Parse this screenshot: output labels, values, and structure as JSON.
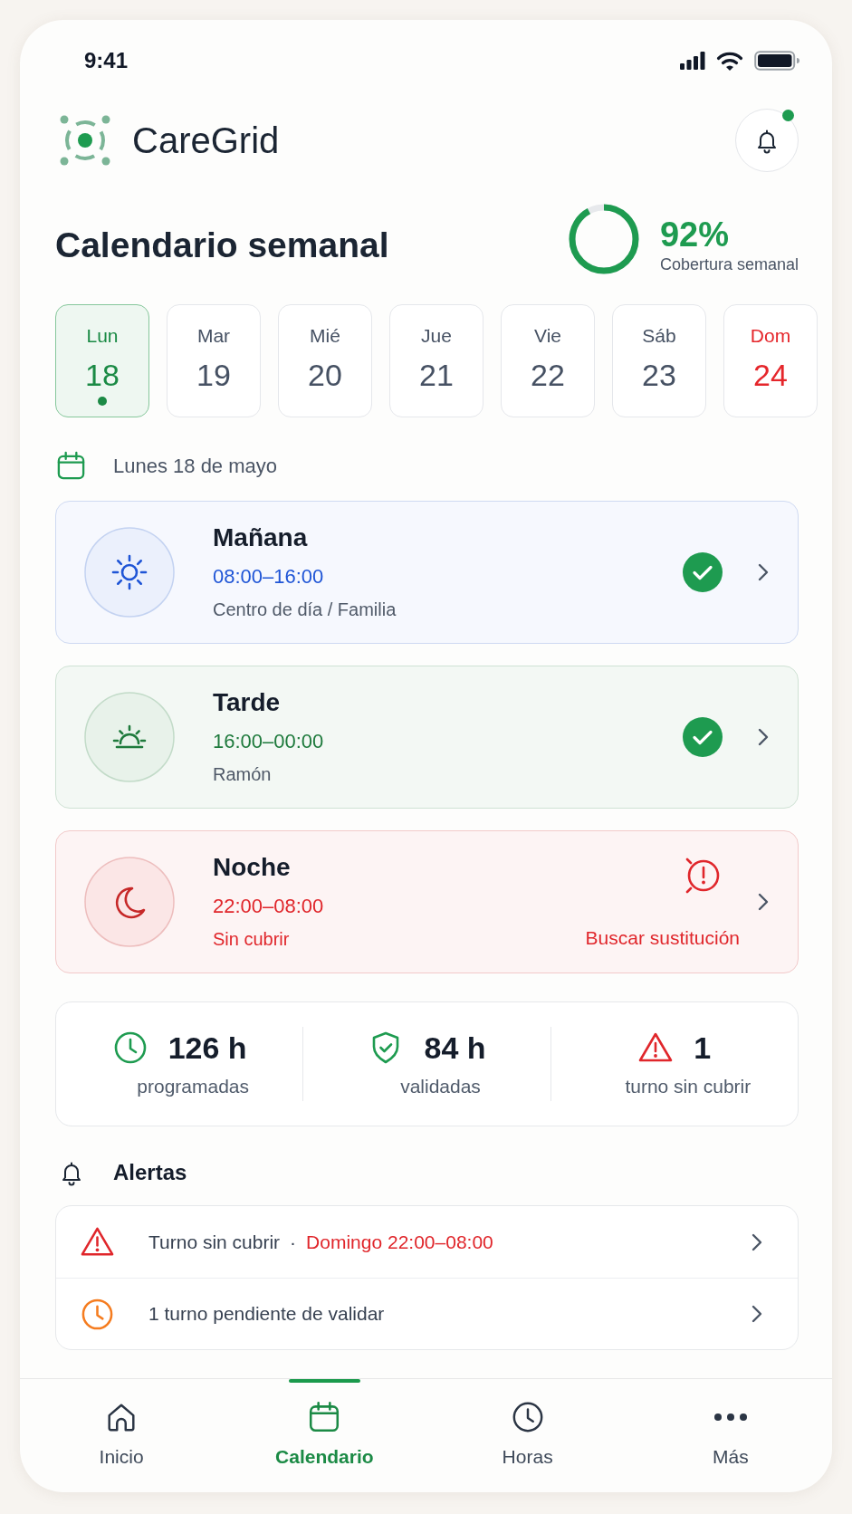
{
  "status_bar": {
    "time": "9:41"
  },
  "header": {
    "app_name": "CareGrid",
    "notifications_unread": true
  },
  "title": "Calendario semanal",
  "coverage": {
    "value": "92%",
    "label": "Cobertura semanal",
    "level": 0.92
  },
  "days": [
    {
      "name": "Lun",
      "number": "18",
      "selected": true,
      "holiday": false
    },
    {
      "name": "Mar",
      "number": "19",
      "selected": false,
      "holiday": false
    },
    {
      "name": "Mié",
      "number": "20",
      "selected": false,
      "holiday": false
    },
    {
      "name": "Jue",
      "number": "21",
      "selected": false,
      "holiday": false
    },
    {
      "name": "Vie",
      "number": "22",
      "selected": false,
      "holiday": false
    },
    {
      "name": "Sáb",
      "number": "23",
      "selected": false,
      "holiday": false
    },
    {
      "name": "Dom",
      "number": "24",
      "selected": false,
      "holiday": true
    }
  ],
  "date_label": "Lunes 18 de mayo",
  "shifts": [
    {
      "kind": "morning",
      "title": "Mañana",
      "time": "08:00–16:00",
      "assignee": "Centro de día / Familia",
      "covered": true
    },
    {
      "kind": "afternoon",
      "title": "Tarde",
      "time": "16:00–00:00",
      "assignee": "Ramón",
      "covered": true
    },
    {
      "kind": "night",
      "title": "Noche",
      "time": "22:00–08:00",
      "assignee": "Sin cubrir",
      "covered": false,
      "action": "Buscar sustitución"
    }
  ],
  "stats": [
    {
      "kind": "scheduled",
      "value": "126 h",
      "label": "programadas"
    },
    {
      "kind": "validated",
      "value": "84 h",
      "label": "validadas"
    },
    {
      "kind": "uncovered",
      "value": "1",
      "label": "turno sin cubrir"
    }
  ],
  "alerts": {
    "title": "Alertas",
    "items": [
      {
        "kind": "warning",
        "text": "Turno sin cubrir",
        "separator": "·",
        "detail": "Domingo 22:00–08:00"
      },
      {
        "kind": "pending",
        "text": "1 turno pendiente de validar"
      }
    ]
  },
  "nav": [
    {
      "label": "Inicio",
      "selected": false
    },
    {
      "label": "Calendario",
      "selected": true
    },
    {
      "label": "Horas",
      "selected": false
    },
    {
      "label": "Más",
      "selected": false
    }
  ]
}
